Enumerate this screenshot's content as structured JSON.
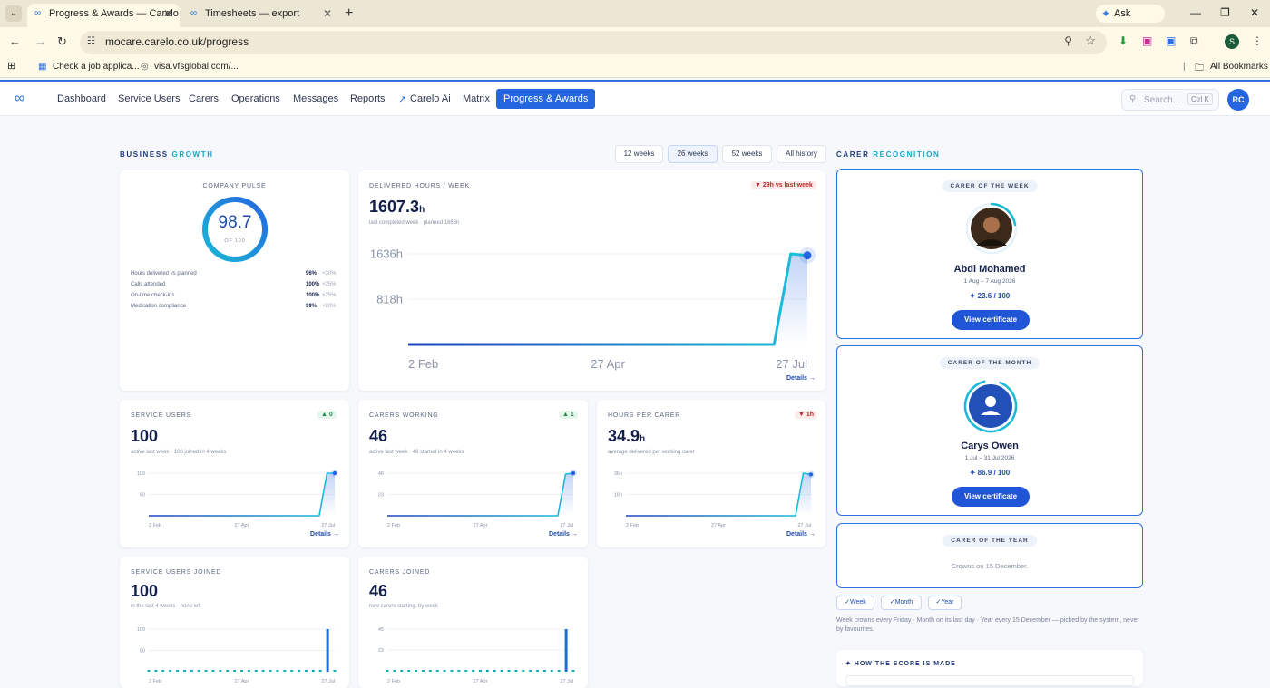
{
  "browser": {
    "tabs": [
      {
        "title": "Progress & Awards — Carelo",
        "active": true
      },
      {
        "title": "Timesheets — export",
        "active": false
      }
    ],
    "ask_gemini": "Ask Gemini",
    "url": "mocare.carelo.co.uk/progress",
    "bookmarks": [
      "Check a job applica...",
      "visa.vfsglobal.com/..."
    ],
    "all_bookmarks": "All Bookmarks",
    "profile_initial": "S"
  },
  "nav": {
    "items": [
      "Dashboard",
      "Service Users",
      "Carers",
      "Operations",
      "Messages",
      "Reports",
      "Carelo Ai",
      "Matrix"
    ],
    "active": "Progress & Awards",
    "search_placeholder": "Search...",
    "search_shortcut": "Ctrl K",
    "user_initials": "RC"
  },
  "growth": {
    "title_a": "BUSINESS",
    "title_b": "GROWTH",
    "ranges": [
      "12 weeks",
      "26 weeks",
      "52 weeks",
      "All history"
    ],
    "selected_range": "26 weeks"
  },
  "pulse": {
    "label": "COMPANY PULSE",
    "score": "98.7",
    "of": "OF 100",
    "score_fraction": 0.987,
    "rows": [
      {
        "name": "Hours delivered vs planned",
        "value": "96%",
        "weight": "×30%"
      },
      {
        "name": "Calls attended",
        "value": "100%",
        "weight": "×25%"
      },
      {
        "name": "On-time check-ins",
        "value": "100%",
        "weight": "×25%"
      },
      {
        "name": "Medication compliance",
        "value": "99%",
        "weight": "×20%"
      }
    ]
  },
  "hours": {
    "label": "DELIVERED HOURS / WEEK",
    "value": "1607.3",
    "unit": "h",
    "sub": "last completed week · planned 1666h",
    "delta": "▼ 29h vs last week",
    "details": "Details →"
  },
  "service_users": {
    "label": "SERVICE USERS",
    "value": "100",
    "sub": "active last week · 100 joined in 4 weeks",
    "delta": "▲ 0",
    "details": "Details →"
  },
  "carers_working": {
    "label": "CARERS WORKING",
    "value": "46",
    "sub": "active last week · 46 started in 4 weeks",
    "delta": "▲ 1",
    "details": "Details →"
  },
  "hours_per_carer": {
    "label": "HOURS PER CARER",
    "value": "34.9",
    "unit": "h",
    "sub": "average delivered per working carer",
    "delta": "▼ 1h",
    "details": "Details →"
  },
  "su_joined": {
    "label": "SERVICE USERS JOINED",
    "value": "100",
    "sub": "in the last 4 weeks · none left"
  },
  "carers_joined": {
    "label": "CARERS JOINED",
    "value": "46",
    "sub": "new carers starting, by week"
  },
  "chart_data": [
    {
      "type": "area",
      "title": "DELIVERED HOURS / WEEK",
      "x_ticks": [
        "2 Feb",
        "27 Apr",
        "27 Jul"
      ],
      "y_ticks": [
        "1636h",
        "818h"
      ],
      "ylim": [
        0,
        1636
      ],
      "values": [
        0,
        0,
        0,
        0,
        0,
        0,
        0,
        0,
        0,
        0,
        0,
        0,
        0,
        0,
        0,
        0,
        0,
        0,
        0,
        0,
        0,
        0,
        0,
        1636,
        1607.3
      ]
    },
    {
      "type": "area",
      "title": "SERVICE USERS",
      "x_ticks": [
        "2 Feb",
        "27 Apr",
        "27 Jul"
      ],
      "y_ticks": [
        "100",
        "50"
      ],
      "ylim": [
        0,
        100
      ],
      "values": [
        0,
        0,
        0,
        0,
        0,
        0,
        0,
        0,
        0,
        0,
        0,
        0,
        0,
        0,
        0,
        0,
        0,
        0,
        0,
        0,
        0,
        0,
        0,
        100,
        100
      ]
    },
    {
      "type": "area",
      "title": "CARERS WORKING",
      "x_ticks": [
        "2 Feb",
        "27 Apr",
        "27 Jul"
      ],
      "y_ticks": [
        "46",
        "23"
      ],
      "ylim": [
        0,
        46
      ],
      "values": [
        0,
        0,
        0,
        0,
        0,
        0,
        0,
        0,
        0,
        0,
        0,
        0,
        0,
        0,
        0,
        0,
        0,
        0,
        0,
        0,
        0,
        0,
        0,
        45,
        46
      ]
    },
    {
      "type": "area",
      "title": "HOURS PER CARER",
      "x_ticks": [
        "2 Feb",
        "27 Apr",
        "27 Jul"
      ],
      "y_ticks": [
        "36h",
        "18h"
      ],
      "ylim": [
        0,
        36
      ],
      "values": [
        0,
        0,
        0,
        0,
        0,
        0,
        0,
        0,
        0,
        0,
        0,
        0,
        0,
        0,
        0,
        0,
        0,
        0,
        0,
        0,
        0,
        0,
        0,
        36,
        34.9
      ]
    },
    {
      "type": "bar",
      "title": "SERVICE USERS JOINED",
      "x_ticks": [
        "2 Feb",
        "27 Apr",
        "27 Jul"
      ],
      "y_ticks": [
        "100",
        "50"
      ],
      "ylim": [
        0,
        100
      ],
      "values": [
        0,
        0,
        0,
        0,
        0,
        0,
        0,
        0,
        0,
        0,
        0,
        0,
        0,
        0,
        0,
        0,
        0,
        0,
        0,
        0,
        0,
        0,
        0,
        0,
        0,
        100,
        0
      ]
    },
    {
      "type": "bar",
      "title": "CARERS JOINED",
      "x_ticks": [
        "2 Feb",
        "27 Apr",
        "27 Jul"
      ],
      "y_ticks": [
        "45",
        "23"
      ],
      "ylim": [
        0,
        45
      ],
      "values": [
        0,
        0,
        0,
        0,
        0,
        0,
        0,
        0,
        0,
        0,
        0,
        0,
        0,
        0,
        0,
        0,
        0,
        0,
        0,
        0,
        0,
        0,
        0,
        0,
        0,
        46,
        0
      ]
    }
  ],
  "recognition": {
    "title_a": "CARER",
    "title_b": "RECOGNITION",
    "week": {
      "tag": "CARER OF THE WEEK",
      "name": "Abdi Mohamed",
      "dates": "1 Aug – 7 Aug 2026",
      "score": "✦ 23.6 / 100",
      "button": "View certificate"
    },
    "month": {
      "tag": "CARER OF THE MONTH",
      "name": "Carys Owen",
      "dates": "1 Jul – 31 Jul 2026",
      "score": "✦ 86.9 / 100",
      "button": "View certificate"
    },
    "year": {
      "tag": "CARER OF THE YEAR",
      "note": "Crowns on 15 December."
    },
    "chips": [
      "✓Week",
      "✓Month",
      "✓Year"
    ],
    "explainer": "Week crowns every Friday · Month on its last day · Year every 15 December — picked by the system, never by favourites.",
    "how_title": "✦ HOW THE SCORE IS MADE"
  },
  "colors": {
    "accent": "#2566e0",
    "teal": "#19b8d6",
    "up": "#1a8a4a",
    "down": "#c02828"
  }
}
